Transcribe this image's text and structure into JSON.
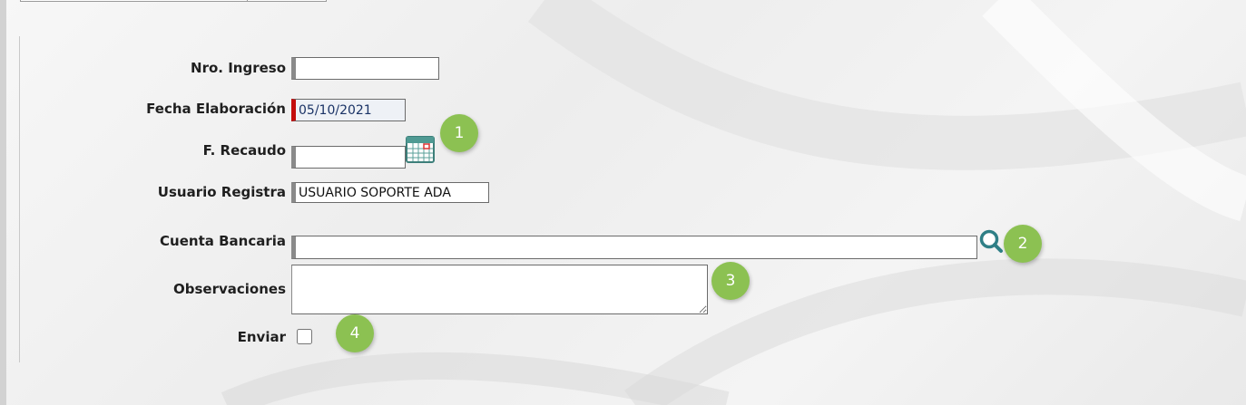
{
  "form": {
    "nro_ingreso": {
      "label": "Nro. Ingreso",
      "value": ""
    },
    "fecha_elaboracion": {
      "label": "Fecha Elaboración",
      "value": "05/10/2021"
    },
    "f_recaudo": {
      "label": "F. Recaudo",
      "value": ""
    },
    "usuario_registra": {
      "label": "Usuario Registra",
      "value": "USUARIO SOPORTE ADA"
    },
    "cuenta_bancaria": {
      "label": "Cuenta Bancaria",
      "value": ""
    },
    "observaciones": {
      "label": "Observaciones",
      "value": ""
    },
    "enviar": {
      "label": "Enviar",
      "checked": false
    }
  },
  "icons": {
    "calendar": "calendar-icon",
    "search": "search-icon"
  },
  "callouts": [
    {
      "number": "1"
    },
    {
      "number": "2"
    },
    {
      "number": "3"
    },
    {
      "number": "4"
    }
  ],
  "colors": {
    "required_marker": "#c40d0d",
    "callout_badge": "#8cc152"
  }
}
